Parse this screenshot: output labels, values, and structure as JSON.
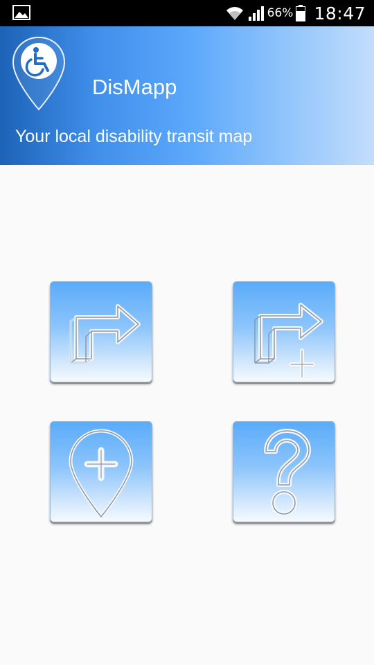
{
  "status_bar": {
    "battery_percent": "66%",
    "time": "18:47",
    "icons": [
      "gallery-icon",
      "wifi-icon",
      "signal-icon",
      "battery-icon"
    ]
  },
  "header": {
    "title": "DisMapp",
    "subtitle": "Your local disability transit map",
    "logo_icon": "wheelchair-map-pin-icon",
    "gradient_colors": [
      "#1d63b8",
      "#5aa7fb",
      "#c3ddfc"
    ]
  },
  "tiles": [
    {
      "name": "route",
      "icon": "route-arrow-icon"
    },
    {
      "name": "add-route",
      "icon": "route-arrow-plus-icon"
    },
    {
      "name": "add-location",
      "icon": "map-pin-plus-icon"
    },
    {
      "name": "help",
      "icon": "question-mark-icon"
    }
  ],
  "colors": {
    "background": "#fafafa",
    "tile_top": "#5aabfa",
    "tile_bottom": "#f6fbff"
  }
}
